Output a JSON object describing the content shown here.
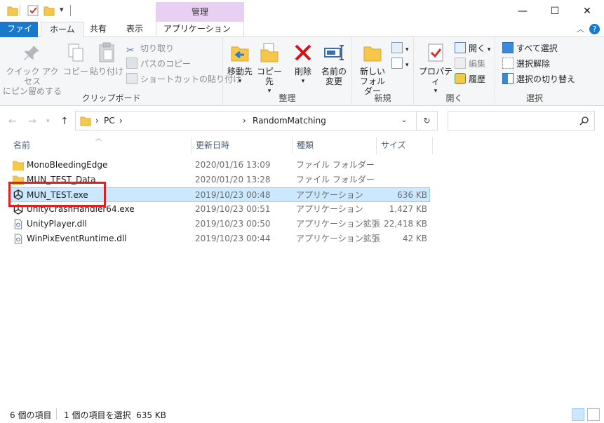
{
  "titlebar": {
    "contextual_tab": "管理",
    "minimize": "—",
    "maximize": "☐",
    "close": "✕"
  },
  "tabs": {
    "file": "ファイル",
    "home": "ホーム",
    "share": "共有",
    "view": "表示",
    "app_tools": "アプリケーション ツール"
  },
  "ribbon": {
    "clipboard": {
      "label": "クリップボード",
      "pin": "クイック アクセス\nにピン留めする",
      "pin_l1": "クイック アクセス",
      "pin_l2": "にピン留めする",
      "copy": "コピー",
      "paste": "貼り付け",
      "cut": "切り取り",
      "copy_path": "パスのコピー",
      "paste_shortcut": "ショートカットの貼り付け"
    },
    "organize": {
      "label": "整理",
      "move_to": "移動先",
      "copy_to": "コピー先",
      "delete": "削除",
      "rename_l1": "名前の",
      "rename_l2": "変更"
    },
    "new": {
      "label": "新規",
      "new_folder_l1": "新しい",
      "new_folder_l2": "フォルダー"
    },
    "open": {
      "label": "開く",
      "properties": "プロパティ",
      "open": "開く",
      "edit": "編集",
      "history": "履歴"
    },
    "select": {
      "label": "選択",
      "select_all": "すべて選択",
      "select_none": "選択解除",
      "invert": "選択の切り替え"
    }
  },
  "address": {
    "crumb_pc": "PC",
    "crumb_folder": "RandomMatching",
    "separator": "›"
  },
  "columns": {
    "name": "名前",
    "date": "更新日時",
    "type": "種類",
    "size": "サイズ"
  },
  "files": [
    {
      "name": "MonoBleedingEdge",
      "date": "2020/01/16 13:09",
      "type": "ファイル フォルダー",
      "size": "",
      "icon": "folder-icon"
    },
    {
      "name": "MUN_TEST_Data",
      "date": "2020/01/20 13:28",
      "type": "ファイル フォルダー",
      "size": "",
      "icon": "folder-icon"
    },
    {
      "name": "MUN_TEST.exe",
      "date": "2019/10/23 00:48",
      "type": "アプリケーション",
      "size": "636 KB",
      "icon": "unity-icon",
      "selected": true
    },
    {
      "name": "UnityCrashHandler64.exe",
      "date": "2019/10/23 00:51",
      "type": "アプリケーション",
      "size": "1,427 KB",
      "icon": "unity-icon"
    },
    {
      "name": "UnityPlayer.dll",
      "date": "2019/10/23 00:50",
      "type": "アプリケーション拡張",
      "size": "22,418 KB",
      "icon": "dll-icon"
    },
    {
      "name": "WinPixEventRuntime.dll",
      "date": "2019/10/23 00:44",
      "type": "アプリケーション拡張",
      "size": "42 KB",
      "icon": "dll-icon"
    }
  ],
  "status": {
    "item_count": "6 個の項目",
    "selection": "1 個の項目を選択  635 KB"
  },
  "colors": {
    "file_tab": "#1979ca",
    "contextual_tab": "#e8d0f3",
    "selection_bg": "#cce8ff",
    "highlight_box": "#e51d1d"
  }
}
